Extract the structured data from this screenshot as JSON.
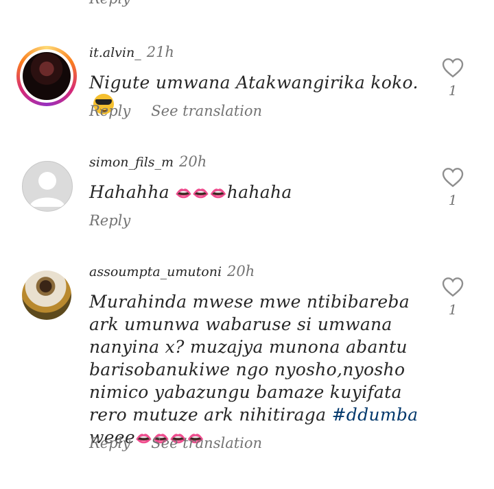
{
  "top_reply": "Reply",
  "comments": [
    {
      "username": "it.alvin_",
      "time": "21h",
      "text": "Nigute umwana Atakwangirika koko.",
      "emoji": "sunglasses",
      "reply": "Reply",
      "translate": "See translation",
      "likes": "1"
    },
    {
      "username": "simon_fils_m",
      "time": "20h",
      "text_pre": "Hahahha ",
      "emojis": "👄👄👄",
      "text_post": "hahaha",
      "reply": "Reply",
      "likes": "1"
    },
    {
      "username": "assoumpta_umutoni",
      "time": "20h",
      "text": "Murahinda mwese mwe ntibibareba ark umunwa wabaruse si umwana nanyina x? muzajya munona abantu barisobanukiwe ngo nyosho,nyosho nimico yabazungu bamaze kuyifata rero mutuze ark nihitiraga ",
      "hashtag": "#ddumba",
      "text_post": " weee",
      "emojis": "👄👄👄👄",
      "reply": "Reply",
      "translate": "See translation",
      "likes": "1"
    }
  ]
}
